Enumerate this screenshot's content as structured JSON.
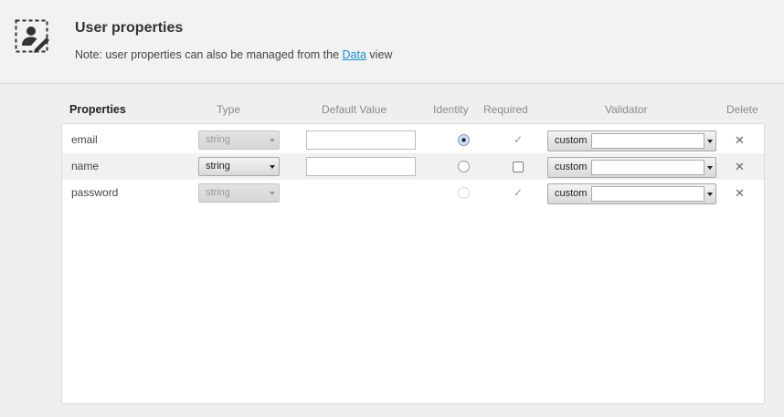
{
  "header": {
    "icon": "edit-user-icon",
    "title": "User properties",
    "note_prefix": "Note: user properties can also be managed from the ",
    "note_link": "Data",
    "note_suffix": " view"
  },
  "columns": {
    "properties": "Properties",
    "type": "Type",
    "default_value": "Default Value",
    "identity": "Identity",
    "required": "Required",
    "validator": "Validator",
    "delete": "Delete"
  },
  "rows": [
    {
      "name": "email",
      "type": "string",
      "type_enabled": false,
      "default_value": "",
      "has_default_input": true,
      "identity": true,
      "identity_enabled": true,
      "required": true,
      "required_enabled": false,
      "validator": "custom",
      "validator_value": "",
      "delete_icon": "close-icon",
      "delete_label": "✕"
    },
    {
      "name": "name",
      "type": "string",
      "type_enabled": true,
      "default_value": "",
      "has_default_input": true,
      "identity": false,
      "identity_enabled": true,
      "required": false,
      "required_enabled": true,
      "validator": "custom",
      "validator_value": "",
      "delete_icon": "close-icon",
      "delete_label": "✕"
    },
    {
      "name": "password",
      "type": "string",
      "type_enabled": false,
      "default_value": "",
      "has_default_input": false,
      "identity": false,
      "identity_enabled": false,
      "required": true,
      "required_enabled": false,
      "validator": "custom",
      "validator_value": "",
      "delete_icon": "close-icon",
      "delete_label": "✕"
    }
  ],
  "colors": {
    "link": "#1a8fc9",
    "background": "#efefef",
    "panel": "#ffffff",
    "row_shade": "#f1f1f1"
  }
}
